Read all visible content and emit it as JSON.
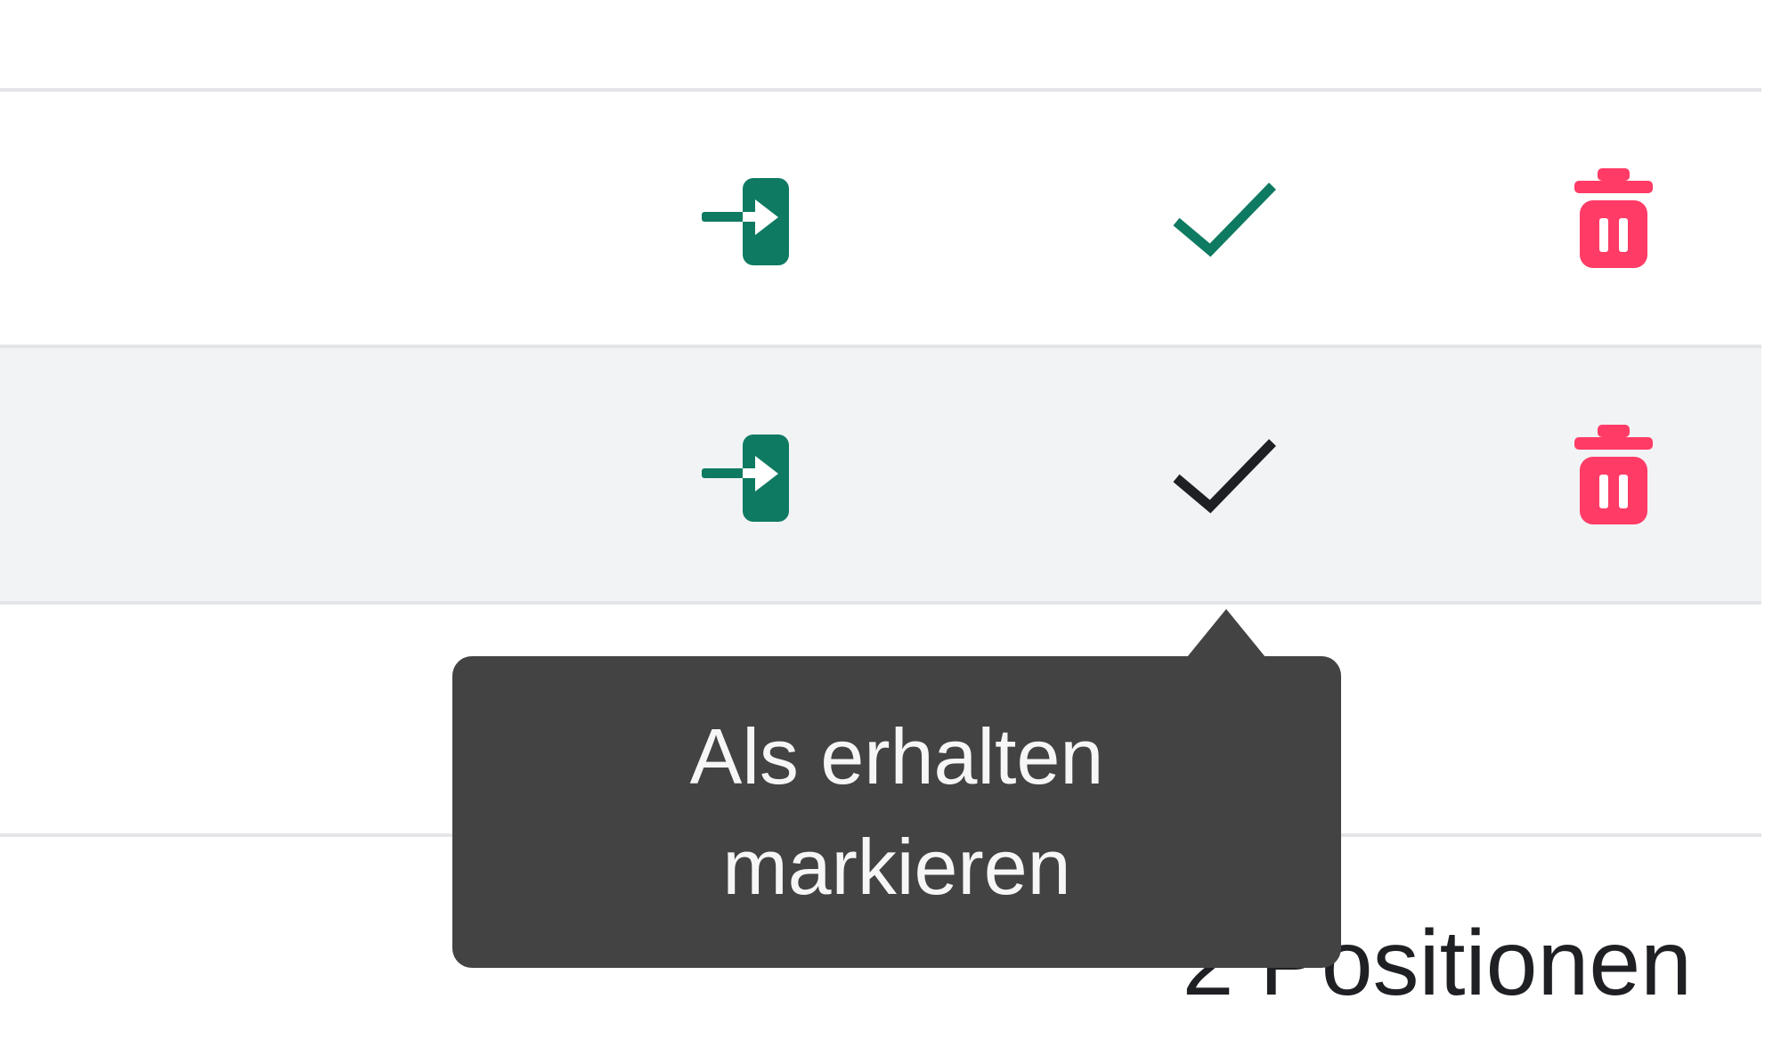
{
  "table": {
    "rows": [
      {
        "enter_icon": "enter-door-icon",
        "check_icon": "checkmark-icon",
        "check_state": "received",
        "delete_icon": "trash-icon"
      },
      {
        "enter_icon": "enter-door-icon",
        "check_icon": "checkmark-icon",
        "check_state": "hovered",
        "delete_icon": "trash-icon"
      }
    ]
  },
  "tooltip": {
    "text": "Als erhalten markieren"
  },
  "footer": {
    "count_label": "2 Positionen"
  },
  "colors": {
    "accent_green": "#0f7a62",
    "delete_red": "#ff3b66",
    "checkmark_dark": "#1f2024",
    "tooltip_bg": "#434343",
    "row_alt_bg": "#f2f3f5",
    "divider": "#e4e5e8"
  }
}
